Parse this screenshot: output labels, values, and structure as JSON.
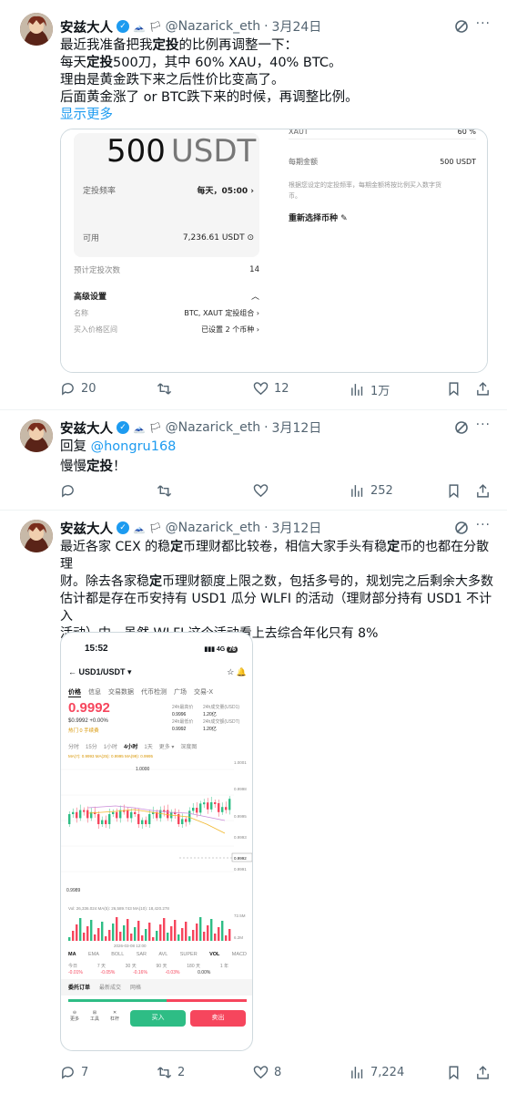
{
  "tweets": [
    {
      "name": "安兹大人",
      "handle": "@Nazarick_eth",
      "dot": "·",
      "date": "3月24日",
      "lines": [
        [
          "最近我准备把我",
          "定投",
          "的比例再调整一下："
        ],
        [
          "每天",
          "定投",
          "500刀，其中 60% XAU，40% BTC。"
        ],
        [
          "理由是黄金跌下来之后性价比变高了。",
          "",
          ""
        ],
        [
          "后面黄金涨了 or BTC跌下来的时候，再调整比例。",
          "",
          ""
        ]
      ],
      "show_more": "显示更多",
      "stats": {
        "reply": "20",
        "retweet": "",
        "like": "12",
        "views": "1万"
      }
    },
    {
      "name": "安兹大人",
      "handle": "@Nazarick_eth",
      "dot": "·",
      "date": "3月12日",
      "reply_prefix": "回复",
      "reply_to": "@hongru168",
      "body_pre": "慢慢",
      "body_bold": "定投",
      "body_post": "！",
      "stats": {
        "reply": "",
        "retweet": "",
        "like": "",
        "views": "252"
      }
    },
    {
      "name": "安兹大人",
      "handle": "@Nazarick_eth",
      "dot": "·",
      "date": "3月12日",
      "lines": [
        [
          "最近各家 CEX 的稳",
          "定",
          "币理财都比较卷，相信大家手头有稳",
          "定",
          "币的也都在分散理"
        ],
        [
          "财。除去各家稳",
          "定",
          "币理财额度上限之数，包括多号的，规划完之后剩余大多数",
          "",
          ""
        ],
        [
          "估计都是存在币安持有 USD1 瓜分 WLFI 的活动（理财部分持有 USD1 不计入",
          "",
          "",
          "",
          ""
        ],
        [
          "活动）中。虽然 WLFI 这个活动看上去综合年化只有 8%",
          "",
          "",
          "",
          ""
        ]
      ],
      "show_more": "显示更多",
      "stats": {
        "reply": "7",
        "retweet": "2",
        "like": "8",
        "views": "7,224"
      }
    }
  ],
  "dca_card": {
    "amount_num": "500",
    "amount_unit": "USDT",
    "freq_label": "定投频率",
    "freq_value": "每天，05:00",
    "avail_label": "可用",
    "avail_value": "7,236.61 USDT",
    "est_label": "预计定投次数",
    "est_value": "14",
    "adv_label": "高级设置",
    "name_label": "名称",
    "name_value": "BTC, XAUT 定投组合",
    "range_label": "买入价格区间",
    "range_value": "已设置 2 个币种",
    "right_xaut": "XAUT",
    "right_xaut_pct": "60 %",
    "right_per_label": "每期金额",
    "right_per_value": "500 USDT",
    "right_desc1": "根据您设定的定投频率，每期金额将按比例买入数字货",
    "right_desc2": "币。",
    "right_reselect": "重新选择币种"
  },
  "trade": {
    "time": "15:52",
    "signal": "4G",
    "battery": "76",
    "pair": "USD1/USDT",
    "tabs": [
      "价格",
      "信息",
      "交易数据",
      "代币检测",
      "广场",
      "交易-X"
    ],
    "price": "0.9992",
    "sub_price": "$0.9992 +0.00%",
    "hot": "热门  0 手续费",
    "h_label": "24h最高价",
    "h_val": "0.9996",
    "l_label": "24h最低价",
    "l_val": "0.9992",
    "v1_label": "24h成交量(USD1)",
    "v1_val": "1.20亿",
    "v2_label": "24h成交额(USDT)",
    "v2_val": "1.20亿",
    "intervals": [
      "分时",
      "15分",
      "1小时",
      "4小时",
      "1天",
      "更多 ▾",
      "深度图"
    ],
    "ma_line": "MA(7): 0.9993   MA(25): 0.9995   MA(99): 0.9995",
    "y_top": "1.0001",
    "y1": "0.9998",
    "y2": "0.9995",
    "y3": "0.9993",
    "y_price": "0.9992",
    "y4": "0.9991",
    "hi_mark": "1.0000",
    "lo_mark": "0.9989",
    "vol_line": "Vol: 26,336.024   MA(5): 26,589.743   MA(10): 18,420.278",
    "vol_top": "72.5M",
    "vol_bot": "6.2M",
    "date": "2026-03-08 12:00",
    "indicators": [
      "MA",
      "EMA",
      "BOLL",
      "SAR",
      "AVL",
      "SUPER",
      "VOL",
      "MACD"
    ],
    "perf_labels": [
      "今日",
      "7 天",
      "30 天",
      "90 天",
      "180 天",
      "1 年"
    ],
    "perf_vals": [
      "-0.01%",
      "-0.05%",
      "-0.16%",
      "-0.03%",
      "0.00%",
      ""
    ],
    "order_tabs": [
      "委托订单",
      "最新成交",
      "网格"
    ],
    "bottom_icons": [
      "更多",
      "工具",
      "杠杆"
    ],
    "buy": "买入",
    "sell": "卖出"
  },
  "colors": {
    "up": "#2ebd85",
    "down": "#f6465d",
    "accent": "#1d9bf0"
  }
}
